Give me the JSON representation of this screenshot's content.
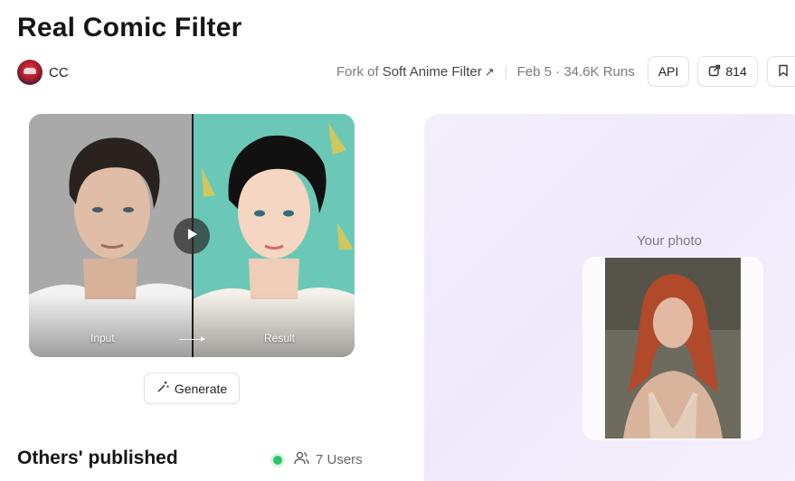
{
  "page": {
    "title": "Real Comic Filter"
  },
  "author": {
    "name": "CC",
    "avatar_icon": "red-mascot-avatar"
  },
  "meta": {
    "fork_prefix": "Fork of",
    "fork_name": "Soft Anime Filter",
    "fork_arrow": "↗",
    "date_runs": "Feb 5 · 34.6K Runs"
  },
  "toolbar": {
    "api_label": "API",
    "share_count": "814",
    "share_icon": "share-icon",
    "bookmark_icon": "bookmark-icon"
  },
  "compare": {
    "input_label": "Input",
    "result_label": "Result",
    "play_icon": "play-icon"
  },
  "generate": {
    "label": "Generate",
    "icon": "magic-wand-icon"
  },
  "others": {
    "title": "Others' published",
    "users_label": "7 Users",
    "status_color": "#2fc26b"
  },
  "preview": {
    "label": "Your photo"
  },
  "colors": {
    "panel_bg": "#f1ecfb",
    "result_bg": "#5fbfae"
  }
}
